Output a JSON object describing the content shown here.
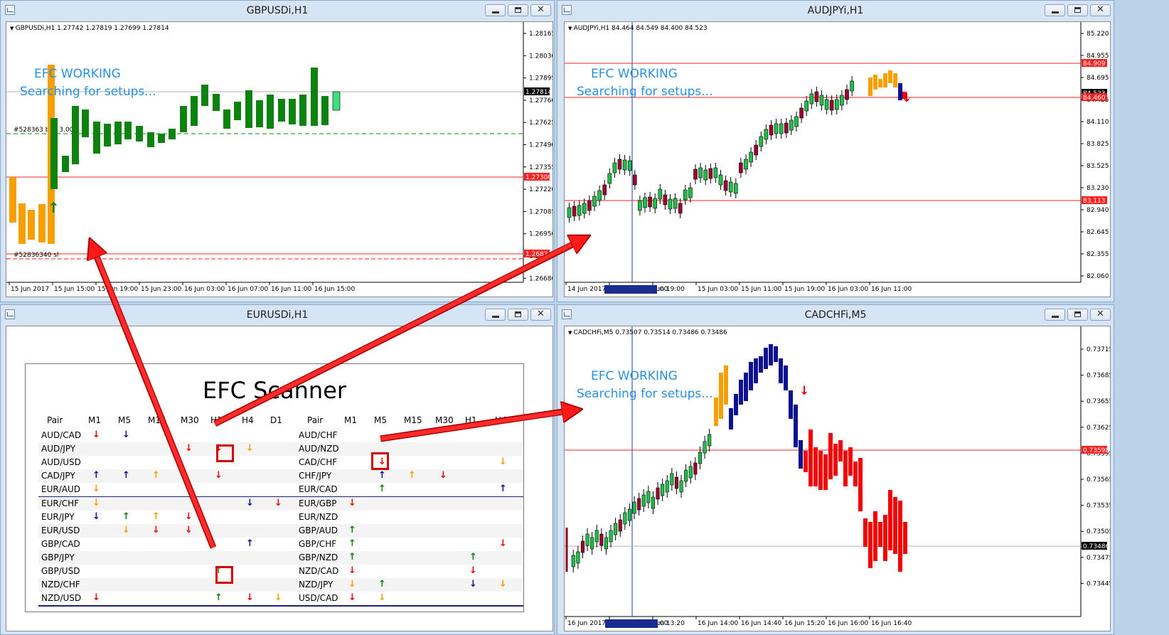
{
  "colors": {
    "up": "#138a13",
    "down": "#f21010",
    "warn": "#f5a000",
    "neutral": "#0a1a96",
    "level": "#ff2020",
    "bull": "#0e820e",
    "amber": "#f5a000",
    "navy": "#0c1190",
    "red": "#f00000",
    "efc_text": "#2a90e0"
  },
  "windows": [
    {
      "title": "GBPUSDi,H1",
      "symbol": "GBPUSDi,H1  1.27742 1.27819 1.27699 1.27814",
      "efc1": "EFC WORKING",
      "efc2": "Searching for setups...",
      "prices": [
        "1.28165",
        "1.28030",
        "1.27895",
        "1.27760",
        "1.27625",
        "1.27490",
        "1.27355",
        "1.27220",
        "1.27085",
        "1.26950",
        "1.26815",
        "1.26680"
      ],
      "times": [
        "15 Jun 2017",
        "15 Jun 15:00",
        "15 Jun 19:00",
        "15 Jun 23:00",
        "16 Jun 03:00",
        "16 Jun 07:00",
        "16 Jun 11:00",
        "16 Jun 15:00"
      ],
      "labels": {
        "current": "1.27814",
        "level1": "1.27300",
        "level2": "1.2682"
      },
      "orders": {
        "buy": "#528363     buy 3.00",
        "sl": "#52836340 sl"
      }
    },
    {
      "title": "AUDJPYi,H1",
      "symbol": "AUDJPYi,H1  84.464 84.549 84.400 84.523",
      "efc1": "EFC WORKING",
      "efc2": "Searching for setups...",
      "prices": [
        "85.220",
        "84.955",
        "84.695",
        "84.425",
        "84.110",
        "83.825",
        "83.525",
        "83.230",
        "82.940",
        "82.645",
        "82.355",
        "82.060"
      ],
      "times": [
        "14 Jun 2017",
        "2017.06.14 15:00",
        "Jun 19:00",
        "15 Jun 03:00",
        "15 Jun 11:00",
        "15 Jun 19:00",
        "16 Jun 03:00",
        "16 Jun 11:00"
      ],
      "labels": {
        "level1": "84.909",
        "current": "84.523",
        "level2": "84.460",
        "level3": "83.113"
      }
    },
    {
      "title": "EURUSDi,H1"
    },
    {
      "title": "CADCHFi,M5",
      "symbol": "CADCHFi,M5  0.73507 0.73514 0.73486 0.73486",
      "efc1": "EFC WORKING",
      "efc2": "Searching for setups...",
      "prices": [
        "0.73715",
        "0.73685",
        "0.73655",
        "0.73625",
        "0.73595",
        "0.73565",
        "0.73535",
        "0.73505",
        "0.73475",
        "0.73445"
      ],
      "times": [
        "16 Jun 2017",
        "2017.06.16 13:00",
        "Jun 13:20",
        "16 Jun 14:00",
        "16 Jun 14:40",
        "16 Jun 15:20",
        "16 Jun 16:00",
        "16 Jun 16:40"
      ],
      "labels": {
        "level1": "0.73598",
        "current": "0.73486"
      }
    }
  ],
  "scanner": {
    "title": "EFC Scanner",
    "headers": [
      "Pair",
      "M1",
      "M5",
      "M15",
      "M30",
      "H1",
      "H4",
      "D1"
    ],
    "headers_right": [
      "Pair",
      "M1",
      "M5",
      "M15",
      "M30",
      "H1",
      "H4"
    ],
    "rows": [
      {
        "left": "AUD/CAD",
        "la": [
          [
            "M1",
            "down"
          ],
          [
            "M5",
            "neutral-down"
          ]
        ],
        "right": "AUD/CHF",
        "ra": []
      },
      {
        "left": "AUD/JPY",
        "la": [
          [
            "M30",
            "down"
          ],
          [
            "H1",
            "down"
          ],
          [
            "H4",
            "warn-down"
          ]
        ],
        "right": "AUD/NZD",
        "ra": []
      },
      {
        "left": "AUD/USD",
        "la": [],
        "right": "CAD/CHF",
        "ra": [
          [
            "M5",
            "down"
          ],
          [
            "H4",
            "warn-down"
          ]
        ]
      },
      {
        "left": "CAD/JPY",
        "la": [
          [
            "M1",
            "neutral-up"
          ],
          [
            "M5",
            "neutral-up"
          ],
          [
            "M15",
            "warn-up"
          ],
          [
            "H1",
            "down"
          ]
        ],
        "right": "CHF/JPY",
        "ra": [
          [
            "M5",
            "neutral-up"
          ],
          [
            "M15",
            "warn-up"
          ],
          [
            "M30",
            "down"
          ]
        ]
      },
      {
        "left": "EUR/AUD",
        "la": [
          [
            "M1",
            "warn-down"
          ]
        ],
        "right": "EUR/CAD",
        "ra": [
          [
            "M5",
            "up"
          ],
          [
            "H4",
            "neutral-up"
          ]
        ]
      },
      {
        "left": "EUR/CHF",
        "la": [
          [
            "M1",
            "warn-down"
          ],
          [
            "H4",
            "neutral-down"
          ],
          [
            "D1",
            "down"
          ]
        ],
        "right": "EUR/GBP",
        "ra": [
          [
            "M1",
            "down"
          ]
        ]
      },
      {
        "left": "EUR/JPY",
        "la": [
          [
            "M1",
            "neutral-down"
          ],
          [
            "M5",
            "up"
          ],
          [
            "M15",
            "warn-up"
          ],
          [
            "M30",
            "down"
          ]
        ],
        "right": "EUR/NZD",
        "ra": []
      },
      {
        "left": "EUR/USD",
        "la": [
          [
            "M5",
            "warn-down"
          ],
          [
            "M15",
            "down"
          ],
          [
            "M30",
            "down"
          ]
        ],
        "right": "GBP/AUD",
        "ra": [
          [
            "M1",
            "up"
          ]
        ]
      },
      {
        "left": "GBP/CAD",
        "la": [
          [
            "H4",
            "neutral-up"
          ]
        ],
        "right": "GBP/CHF",
        "ra": [
          [
            "M1",
            "up"
          ],
          [
            "H4",
            "down"
          ]
        ]
      },
      {
        "left": "GBP/JPY",
        "la": [],
        "right": "GBP/NZD",
        "ra": [
          [
            "M1",
            "up"
          ],
          [
            "H1",
            "up"
          ]
        ]
      },
      {
        "left": "GBP/USD",
        "la": [
          [
            "H1",
            "up"
          ]
        ],
        "right": "NZD/CAD",
        "ra": [
          [
            "M1",
            "down"
          ],
          [
            "H1",
            "down"
          ]
        ]
      },
      {
        "left": "NZD/CHF",
        "la": [],
        "right": "NZD/JPY",
        "ra": [
          [
            "M1",
            "warn-down"
          ],
          [
            "M5",
            "up"
          ],
          [
            "H1",
            "neutral-down"
          ],
          [
            "H4",
            "warn-down"
          ]
        ]
      },
      {
        "left": "NZD/USD",
        "la": [
          [
            "M1",
            "down"
          ],
          [
            "H1",
            "up"
          ],
          [
            "H4",
            "down"
          ],
          [
            "D1",
            "warn-down"
          ]
        ],
        "right": "USD/CAD",
        "ra": [
          [
            "M1",
            "down"
          ],
          [
            "M5",
            "warn-down"
          ]
        ]
      }
    ]
  }
}
